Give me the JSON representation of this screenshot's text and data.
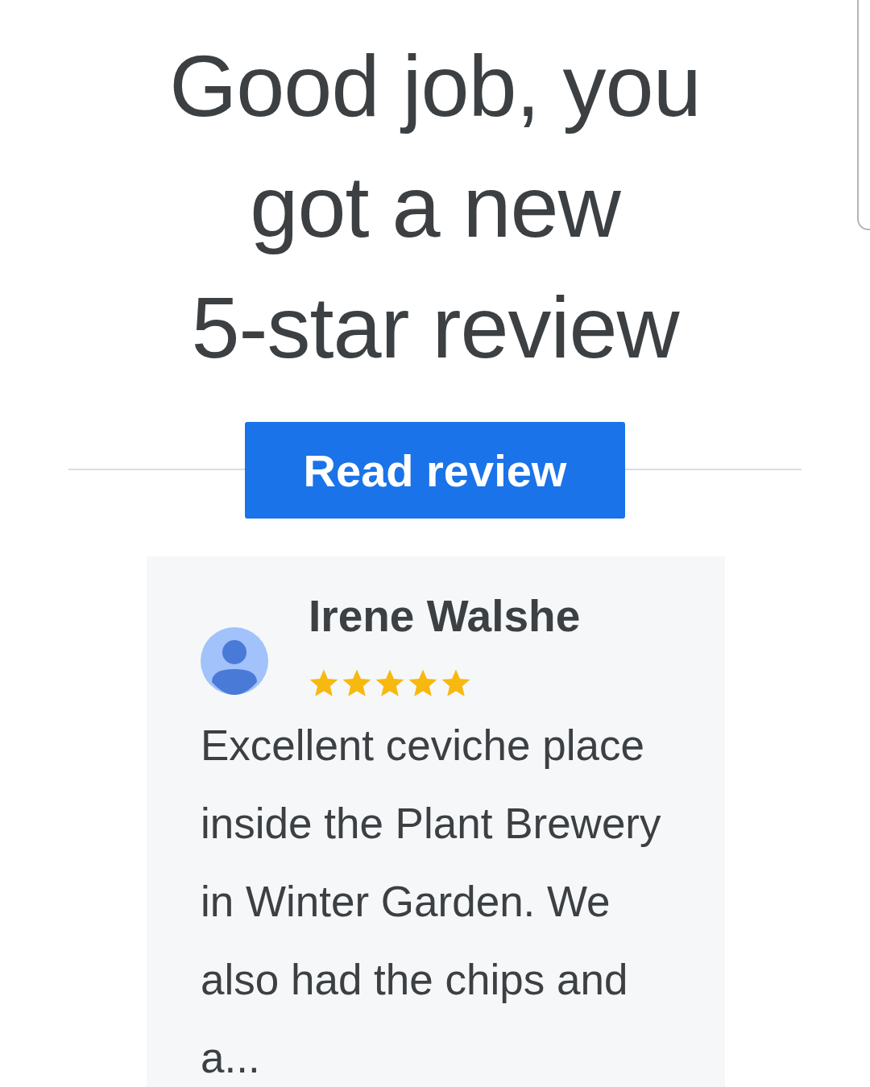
{
  "headline": [
    "Good job, you",
    "got a new",
    "5-star review"
  ],
  "button": {
    "label": "Read review"
  },
  "review": {
    "author": "Irene Walshe",
    "stars": 5,
    "text": "Excellent ceviche place inside the Plant Brewery in Winter Garden. We also had the chips and a..."
  }
}
